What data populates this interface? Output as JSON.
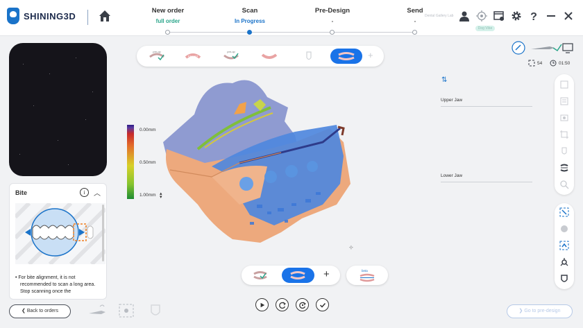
{
  "brand": {
    "name": "SHINING3D"
  },
  "steps": [
    {
      "label": "New order",
      "sub": "full order",
      "sub_color": "#2aa58a"
    },
    {
      "label": "Scan",
      "sub": "In Progress",
      "sub_color": "#1a73c9"
    },
    {
      "label": "Pre-Design",
      "sub": "-",
      "sub_color": "#555"
    },
    {
      "label": "Send",
      "sub": "-",
      "sub_color": "#555"
    }
  ],
  "header": {
    "lab_name": "Dental Gallery Lab",
    "tip_badge": "Dog Vibe"
  },
  "top_icons": [
    "user-icon",
    "target-icon",
    "window-settings-icon",
    "gear-icon",
    "help-icon",
    "minimize-icon",
    "close-icon"
  ],
  "scan_steps": [
    {
      "label": "pre-op",
      "icon": "upper-preop-icon"
    },
    {
      "label": "",
      "icon": "upper-jaw-icon"
    },
    {
      "label": "pre-op",
      "icon": "lower-preop-icon"
    },
    {
      "label": "",
      "icon": "lower-jaw-icon"
    },
    {
      "label": "",
      "icon": "single-tooth-icon"
    },
    {
      "label": "",
      "icon": "bite-icon"
    }
  ],
  "color_scale": {
    "top": "0.00mm",
    "mid": "0.50mm",
    "bottom": "1.00mm"
  },
  "jaw_labels": {
    "upper": "Upper Jaw",
    "lower": "Lower Jaw"
  },
  "counters": {
    "count": "54",
    "time": "01:50"
  },
  "bite_panel": {
    "title": "Bite",
    "text": "For bite alignment, it is not recommended to scan a long area. Stop scanning once the"
  },
  "bottom_bar": {
    "beta": "beta",
    "plus": "+"
  },
  "buttons": {
    "back": "Back to orders",
    "next": "Go to pre-design"
  },
  "colors": {
    "accent": "#1a73e8",
    "brand": "#1a73c9",
    "done": "#2aa58a"
  }
}
